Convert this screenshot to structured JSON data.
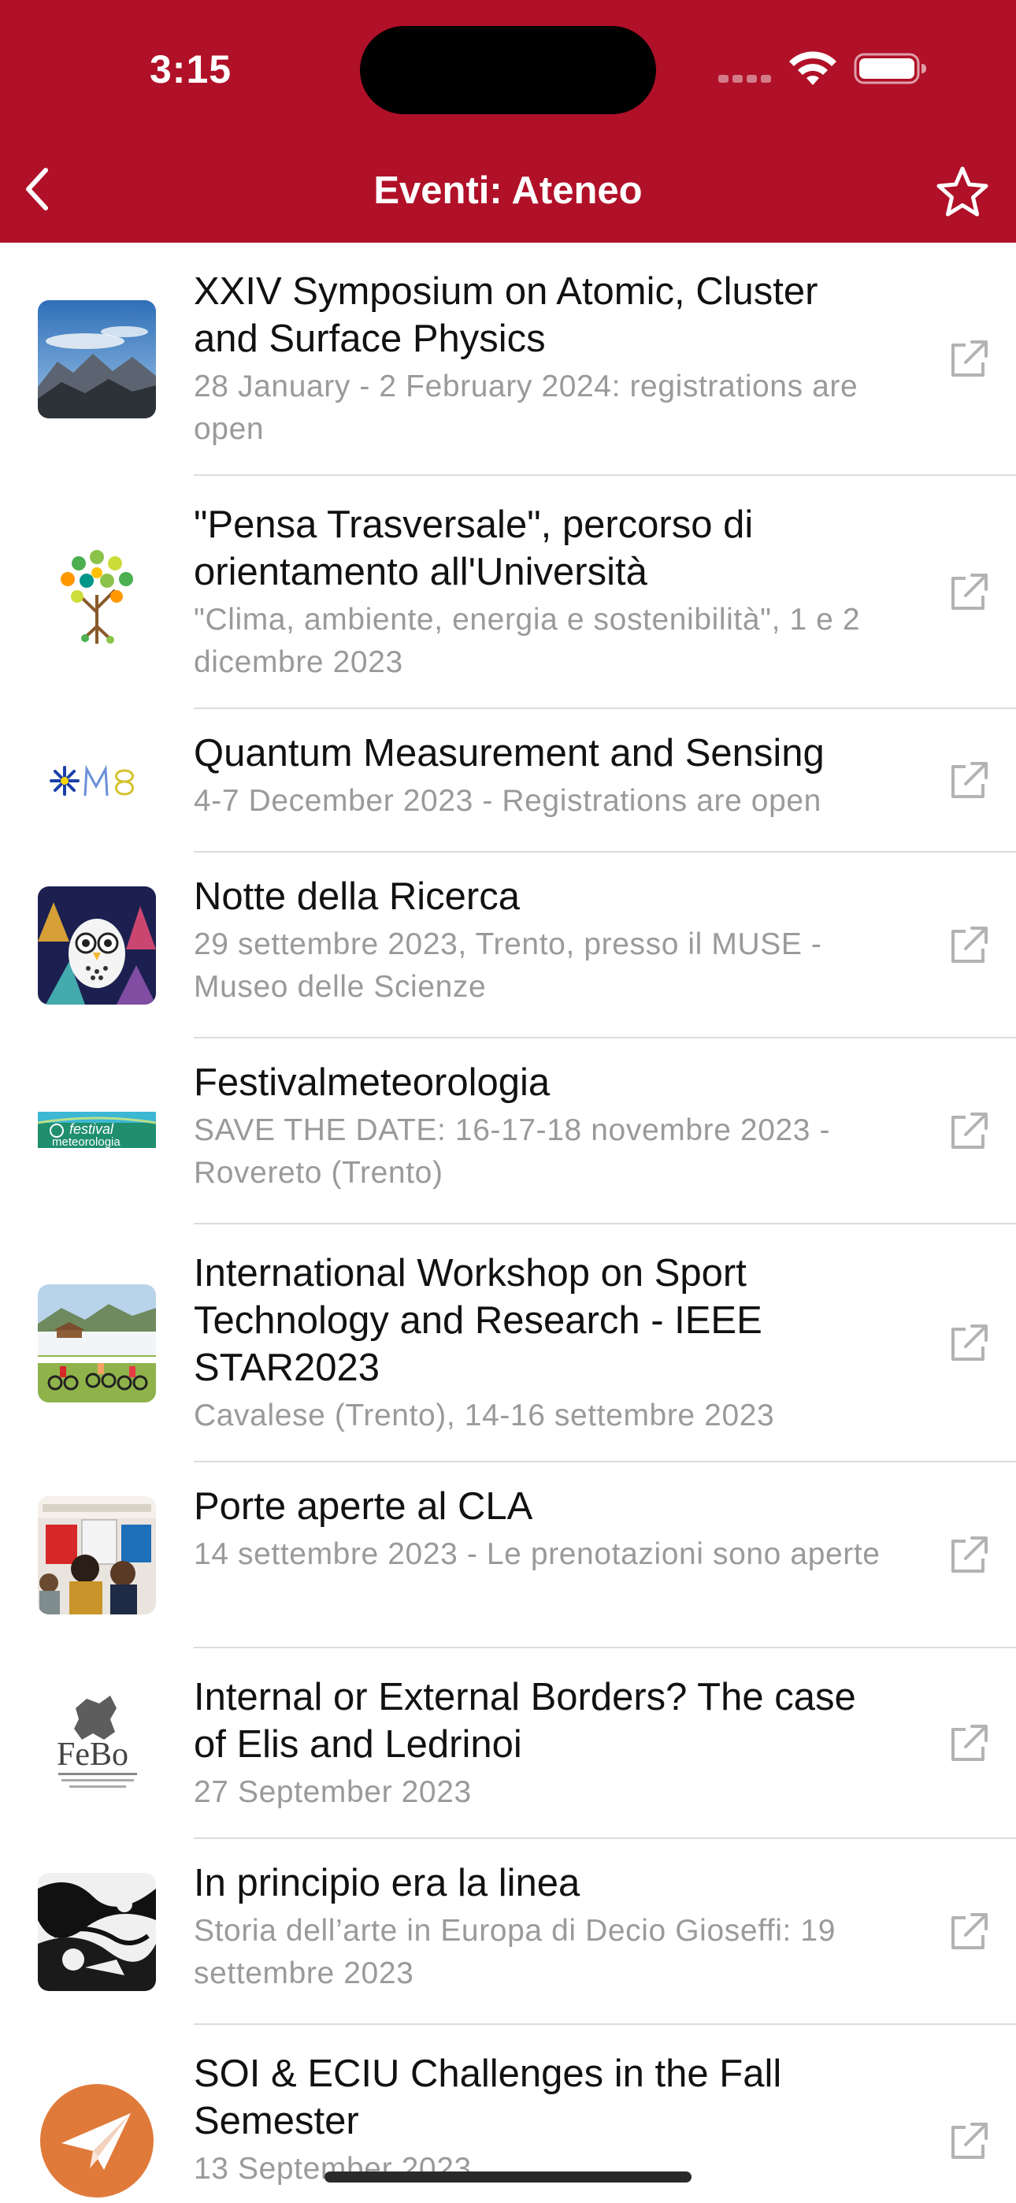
{
  "status_bar": {
    "time": "3:15"
  },
  "nav": {
    "title": "Eventi: Ateneo"
  },
  "colors": {
    "header": "#b01028",
    "subtitle": "#9a9a9a",
    "icon": "#b3b3b3"
  },
  "icons": {
    "back": "chevron-left",
    "favorite": "star-outline",
    "row_action": "external-link"
  },
  "events": [
    {
      "title": "XXIV Symposium on Atomic, Cluster and Surface Physics",
      "subtitle": "28 January - 2 February 2024: registrations are open",
      "thumbnail": "mountains-photo"
    },
    {
      "title": "\"Pensa Trasversale\", percorso di orientamento all'Università",
      "subtitle": "\"Clima, ambiente, energia e sostenibilità\", 1 e 2 dicembre 2023",
      "thumbnail": "tree-logo"
    },
    {
      "title": "Quantum Measurement and Sensing",
      "subtitle": "4-7 December 2023 - Registrations are open",
      "thumbnail": "qms-logo"
    },
    {
      "title": "Notte della Ricerca",
      "subtitle": "29 settembre 2023, Trento, presso il MUSE - Museo delle Scienze",
      "thumbnail": "owl-illustration"
    },
    {
      "title": "Festivalmeteorologia",
      "subtitle": "SAVE THE DATE: 16-17-18 novembre 2023 - Rovereto (Trento)",
      "thumbnail": "festival-meteorologia-logo"
    },
    {
      "title": "International Workshop on Sport Technology and Research - IEEE STAR2023",
      "subtitle": "Cavalese (Trento), 14-16 settembre 2023",
      "thumbnail": "cyclists-photo"
    },
    {
      "title": "Porte aperte al CLA",
      "subtitle": "14 settembre 2023 - Le prenotazioni sono aperte",
      "thumbnail": "students-photo"
    },
    {
      "title": "Internal or External Borders? The case of Elis and Ledrinoi",
      "subtitle": "27 September 2023",
      "thumbnail": "febo-logo"
    },
    {
      "title": "In principio era la linea",
      "subtitle": "Storia dell’arte in Europa di Decio Gioseffi: 19 settembre 2023",
      "thumbnail": "ink-drawing"
    },
    {
      "title": "SOI & ECIU Challenges in the Fall Semester",
      "subtitle": "13 September 2023",
      "thumbnail": "paper-plane-logo"
    }
  ],
  "thumb_text": {
    "festival_line1": "festival",
    "festival_line2": "meteorologia",
    "febo": "FeBo"
  }
}
